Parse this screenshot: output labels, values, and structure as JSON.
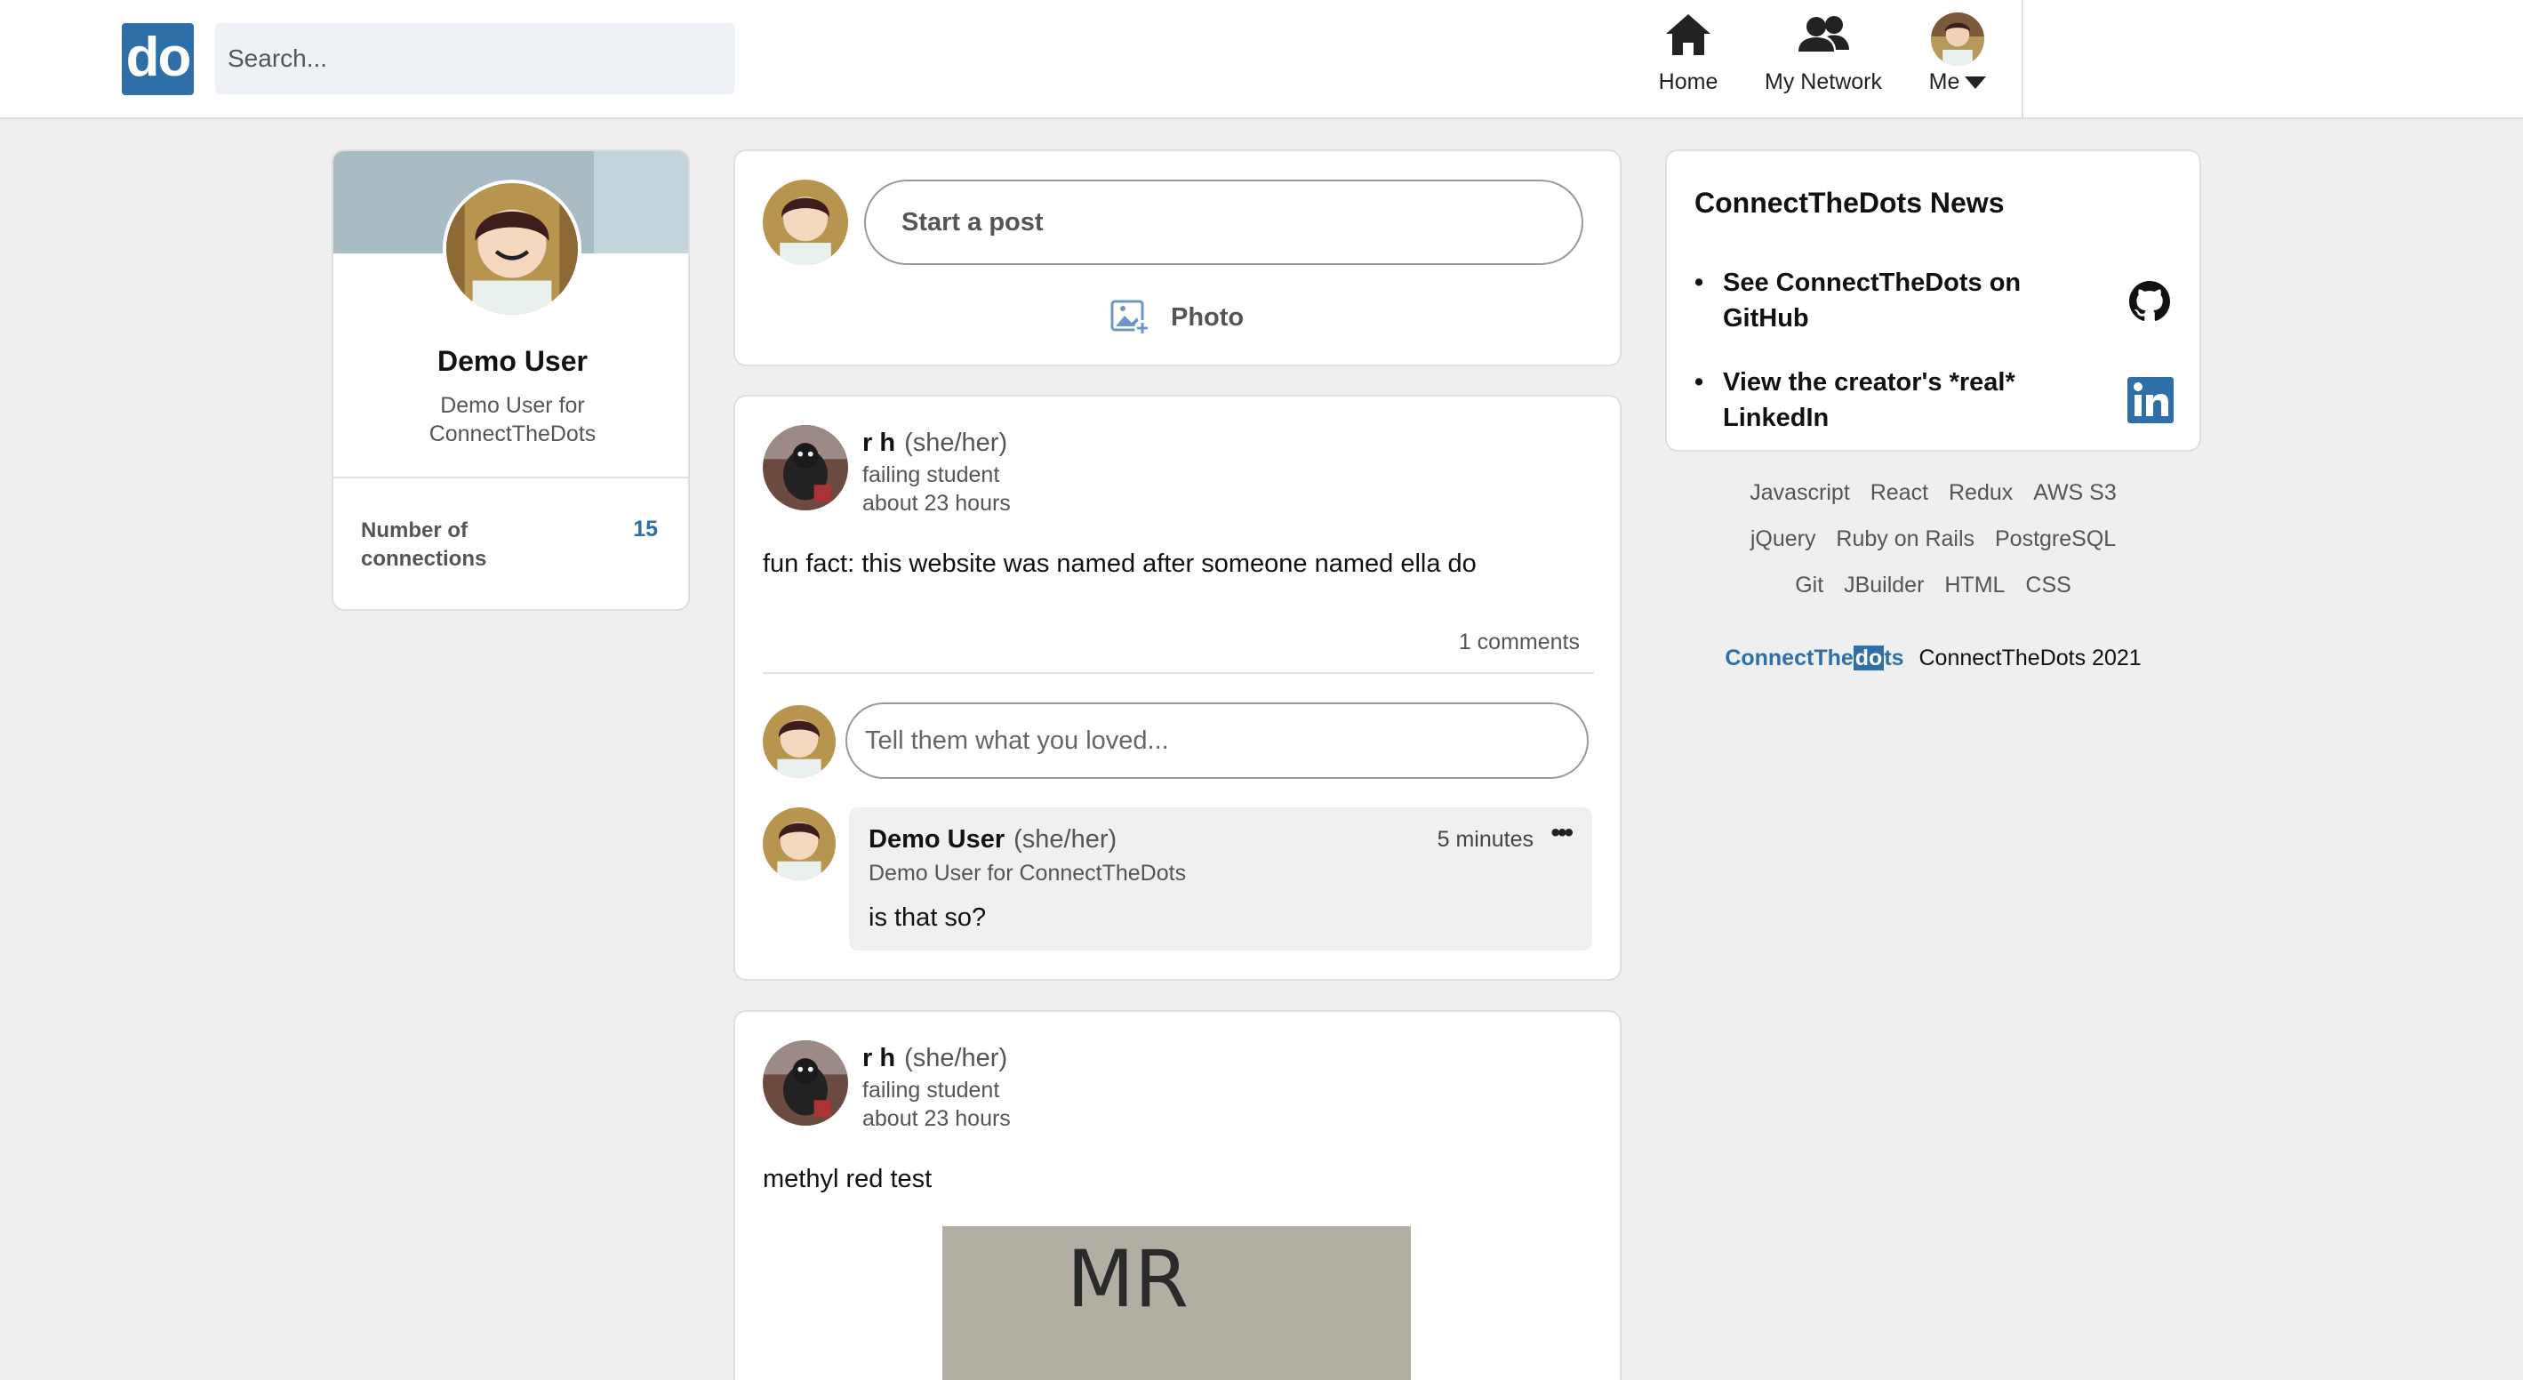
{
  "header": {
    "logo_text": "do",
    "search_placeholder": "Search...",
    "nav": {
      "home": "Home",
      "network": "My Network",
      "me": "Me"
    }
  },
  "profile": {
    "name": "Demo User",
    "headline": "Demo User for ConnectTheDots",
    "connections_label": "Number of connections",
    "connections_count": "15"
  },
  "composer": {
    "start_label": "Start a post",
    "photo_label": "Photo"
  },
  "posts": [
    {
      "author": "r h",
      "pronouns": "(she/her)",
      "headline": "failing student",
      "time": "about 23 hours",
      "body": "fun fact: this website was named after someone named ella do",
      "comments_count": "1 comments",
      "comment_placeholder": "Tell them what you loved...",
      "comments": [
        {
          "author": "Demo User",
          "pronouns": "(she/her)",
          "headline": "Demo User for ConnectTheDots",
          "time": "5 minutes",
          "text": "is that so?"
        }
      ]
    },
    {
      "author": "r h",
      "pronouns": "(she/her)",
      "headline": "failing student",
      "time": "about 23 hours",
      "body": "methyl red test",
      "image_text": "MR"
    }
  ],
  "news": {
    "title": "ConnectTheDots News",
    "items": [
      {
        "label": "See ConnectTheDots on GitHub",
        "icon": "github-icon"
      },
      {
        "label": "View the creator's *real* LinkedIn",
        "icon": "linkedin-icon"
      }
    ]
  },
  "tech_tags": [
    "Javascript",
    "React",
    "Redux",
    "AWS S3",
    "jQuery",
    "Ruby on Rails",
    "PostgreSQL",
    "Git",
    "JBuilder",
    "HTML",
    "CSS"
  ],
  "footer": {
    "brand_prefix": "ConnectThe",
    "brand_do": "do",
    "brand_suffix": "ts",
    "copyright": "ConnectTheDots 2021"
  },
  "colors": {
    "brand": "#2f6fa8",
    "background": "#efefef"
  }
}
